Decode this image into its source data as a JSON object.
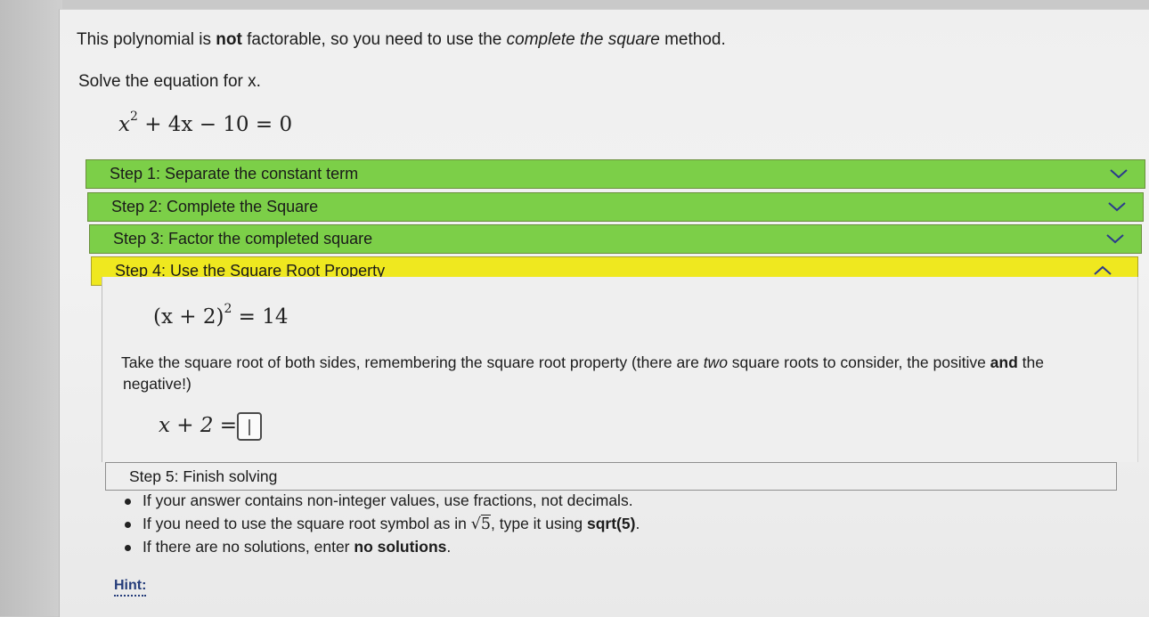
{
  "intro": {
    "part1": "This polynomial is ",
    "bold": "not",
    "part2": " factorable, so you need to use the ",
    "italic": "complete the square",
    "part3": " method."
  },
  "instruction": "Solve the equation for x.",
  "equation": {
    "base": "x",
    "exp": "2",
    "rest": " + 4x − 10 = 0"
  },
  "steps": [
    {
      "label": "Step 1: Separate the constant term",
      "state": "collapsed",
      "color": "#7ccf48"
    },
    {
      "label": "Step 2: Complete the Square",
      "state": "collapsed",
      "color": "#7ccf48"
    },
    {
      "label": "Step 3: Factor the completed square",
      "state": "collapsed",
      "color": "#7ccf48"
    },
    {
      "label": "Step 4: Use the Square Root Property",
      "state": "expanded",
      "color": "#efe81f"
    },
    {
      "label": "Step 5: Finish solving",
      "state": "plain",
      "color": "#eeeeee"
    }
  ],
  "step4": {
    "equation_left": "(x + 2)",
    "equation_exp": "2",
    "equation_right": " = 14",
    "explain_part1": "Take the square root of both sides, remembering the square root property (there are ",
    "explain_italic": "two",
    "explain_part2": " square roots to consider, the positive ",
    "explain_bold": "and",
    "explain_part3": " the",
    "explain_line2": "negative!)",
    "answer_left": "x + 2 =",
    "answer_value": ""
  },
  "step5_bullets": {
    "b1": "If your answer contains non-integer values, use fractions, not decimals.",
    "b2_part1": "If you need to use the square root symbol as in ",
    "b2_sqrt_sign": "√",
    "b2_sqrt_arg": "5",
    "b2_part2": ", type it using ",
    "b2_bold": "sqrt(5)",
    "b2_part3": ".",
    "b3_part1": "If there are no solutions, enter ",
    "b3_bold": "no solutions",
    "b3_part2": "."
  },
  "hint_label": "Hint:"
}
